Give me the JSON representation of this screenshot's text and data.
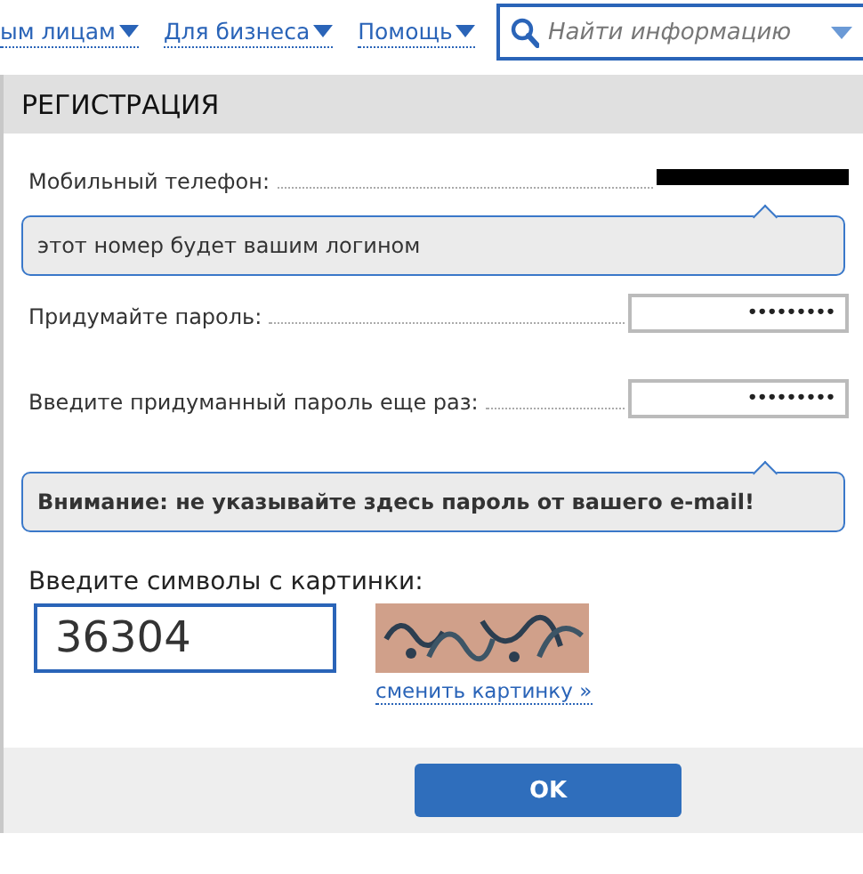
{
  "nav": {
    "links": [
      {
        "label": "ым лицам"
      },
      {
        "label": "Для бизнеса"
      },
      {
        "label": "Помощь"
      }
    ],
    "search": {
      "placeholder": "Найти информацию"
    }
  },
  "dialog": {
    "title": "РЕГИСТРАЦИЯ",
    "rows": [
      {
        "kind": "phone",
        "label": "Мобильный телефон:"
      },
      {
        "kind": "hint",
        "text": "этот номер будет вашим логином"
      },
      {
        "kind": "password",
        "label": "Придумайте пароль:",
        "value": "•••••••••"
      },
      {
        "kind": "password",
        "label": "Введите придуманный пароль еще раз:",
        "value": "•••••••••"
      },
      {
        "kind": "warning",
        "text": "Внимание: не указывайте здесь пароль от вашего e-mail!"
      }
    ],
    "captcha": {
      "label": "Введите символы с картинки:",
      "value": "36304",
      "link": "сменить картинку »"
    },
    "button": "OK"
  }
}
